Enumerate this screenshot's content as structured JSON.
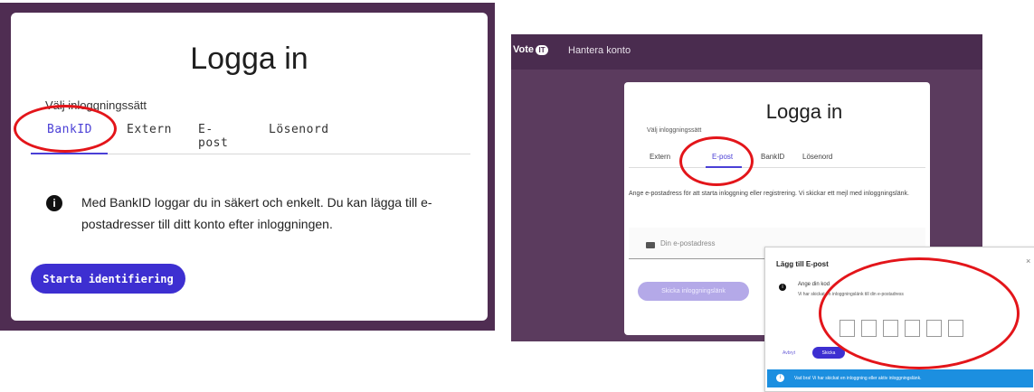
{
  "left_panel": {
    "title": "Logga in",
    "subtitle": "Välj inloggningssätt",
    "tabs": [
      {
        "label": "BankID",
        "active": true
      },
      {
        "label": "Extern",
        "active": false
      },
      {
        "label": "E-post",
        "active": false
      },
      {
        "label": "Lösenord",
        "active": false
      }
    ],
    "info_icon": "info-icon",
    "info_text": "Med BankID loggar du in säkert och enkelt. Du kan lägga till e-postadresser till ditt konto efter inloggningen.",
    "button_label": "Starta identifiering"
  },
  "right_panel": {
    "logo": "Vote",
    "logo_badge": "IT",
    "nav_link": "Hantera konto",
    "title": "Logga in",
    "subtitle": "Välj inloggningssätt",
    "tabs": [
      {
        "label": "Extern",
        "active": false
      },
      {
        "label": "E-post",
        "active": true
      },
      {
        "label": "BankID",
        "active": false
      },
      {
        "label": "Lösenord",
        "active": false
      }
    ],
    "description": "Ange e-postadress för att starta inloggning eller registrering. Vi skickar ett mejl med inloggningslänk.",
    "email_placeholder": "Din e-postadress",
    "submit_label": "Skicka inloggningslänk"
  },
  "modal": {
    "title": "Lägg till E-post",
    "close": "×",
    "info_line1": "Ange din kod",
    "info_line2": "Vi har skickat en inloggningslänk till din e-postadress",
    "code_boxes": 6,
    "cancel_label": "Avbryt",
    "ok_label": "Skicka",
    "toast_text": "Vad bra! Vi har skickat en inloggning eller aktiv inloggningslänk."
  },
  "colors": {
    "brand_purple": "#4f2d52",
    "accent_blue": "#3d2fd1",
    "annotation_red": "#e3151a",
    "toast_blue": "#1c8fe0"
  }
}
